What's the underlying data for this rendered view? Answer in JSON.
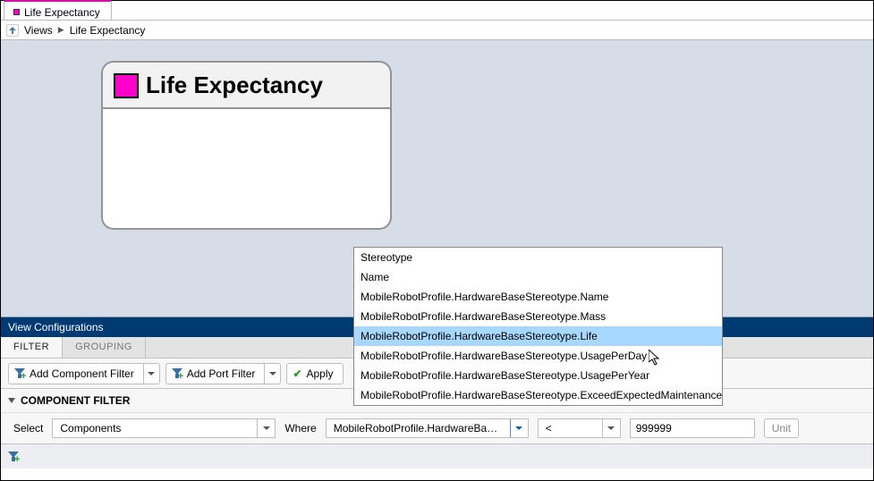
{
  "tab": {
    "title": "Life Expectancy"
  },
  "breadcrumb": {
    "root": "Views",
    "current": "Life Expectancy"
  },
  "diagram": {
    "title": "Life Expectancy"
  },
  "viewConfig": {
    "title": "View Configurations"
  },
  "subTabs": {
    "filter": "FILTER",
    "grouping": "GROUPING"
  },
  "toolbar": {
    "addCompFilter": "Add Component Filter",
    "addPortFilter": "Add Port Filter",
    "apply": "Apply"
  },
  "sectionHead": "COMPONENT FILTER",
  "filterRow": {
    "selectLabel": "Select",
    "selectValue": "Components",
    "whereLabel": "Where",
    "propValue": "MobileRobotProfile.HardwareBaseSte...",
    "opValue": "<",
    "numValue": "999999",
    "unitLabel": "Unit"
  },
  "dropdown": {
    "options": [
      "Stereotype",
      "Name",
      "MobileRobotProfile.HardwareBaseStereotype.Name",
      "MobileRobotProfile.HardwareBaseStereotype.Mass",
      "MobileRobotProfile.HardwareBaseStereotype.Life",
      "MobileRobotProfile.HardwareBaseStereotype.UsagePerDay",
      "MobileRobotProfile.HardwareBaseStereotype.UsagePerYear",
      "MobileRobotProfile.HardwareBaseStereotype.ExceedExpectedMaintenance"
    ],
    "selectedIndex": 4
  }
}
